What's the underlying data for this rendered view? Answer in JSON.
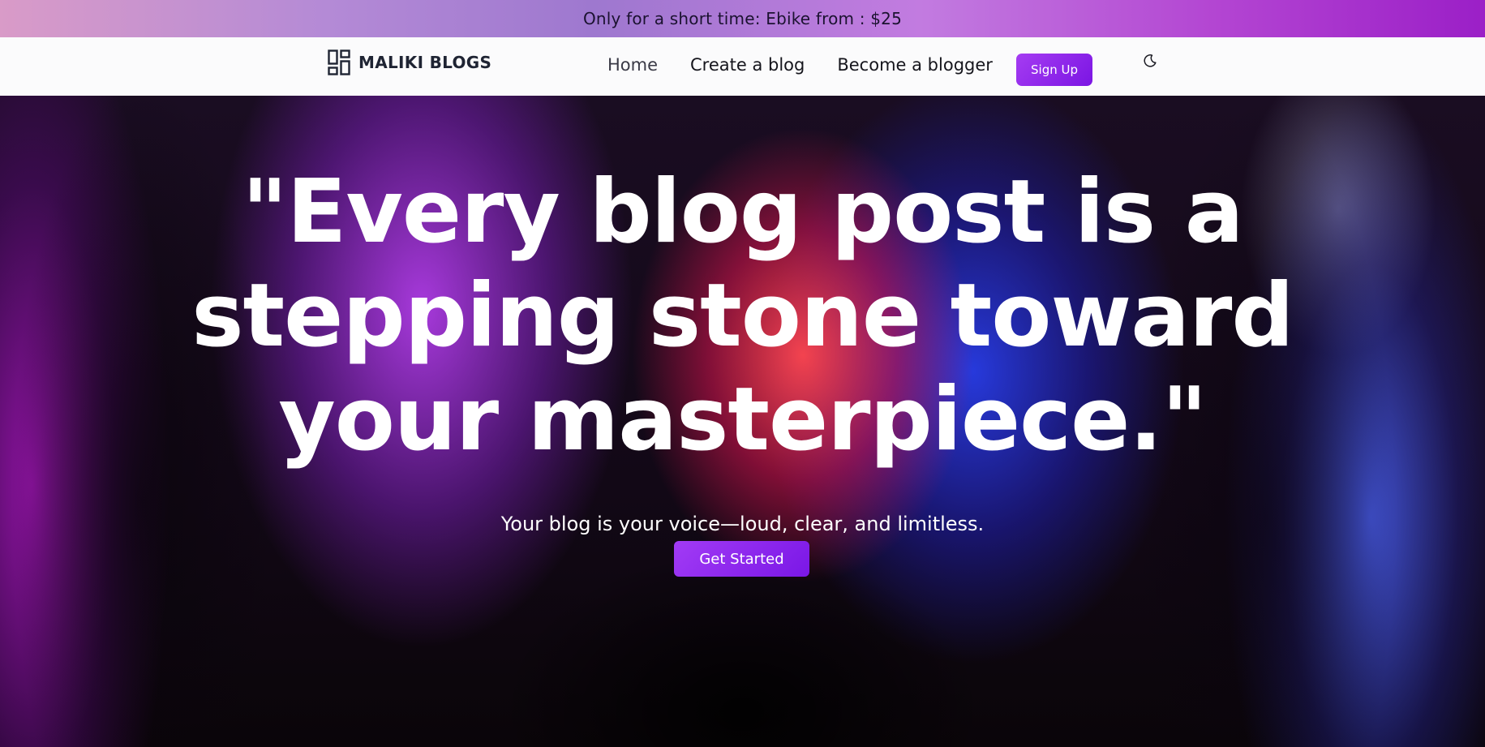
{
  "promo": {
    "text": "Only for a short time: Ebike from : $25"
  },
  "brand": {
    "icon": "dashboard-grid-icon",
    "name": "MALIKI BLOGS"
  },
  "nav": {
    "links": [
      {
        "label": "Home"
      },
      {
        "label": "Create a blog"
      },
      {
        "label": "Become a blogger"
      }
    ],
    "signup_label": "Sign Up",
    "theme_toggle_icon": "moon-icon"
  },
  "hero": {
    "headline_lines": [
      "\"Every blog post is a",
      "stepping stone toward",
      "your masterpiece.\""
    ],
    "subtitle": "Your blog is your voice—loud, clear, and limitless.",
    "cta_label": "Get Started"
  },
  "colors": {
    "accent": "#8a22ea",
    "accent_light": "#a53cf2",
    "nav_bg": "#fbfbfc",
    "hero_text": "#ffffff"
  }
}
